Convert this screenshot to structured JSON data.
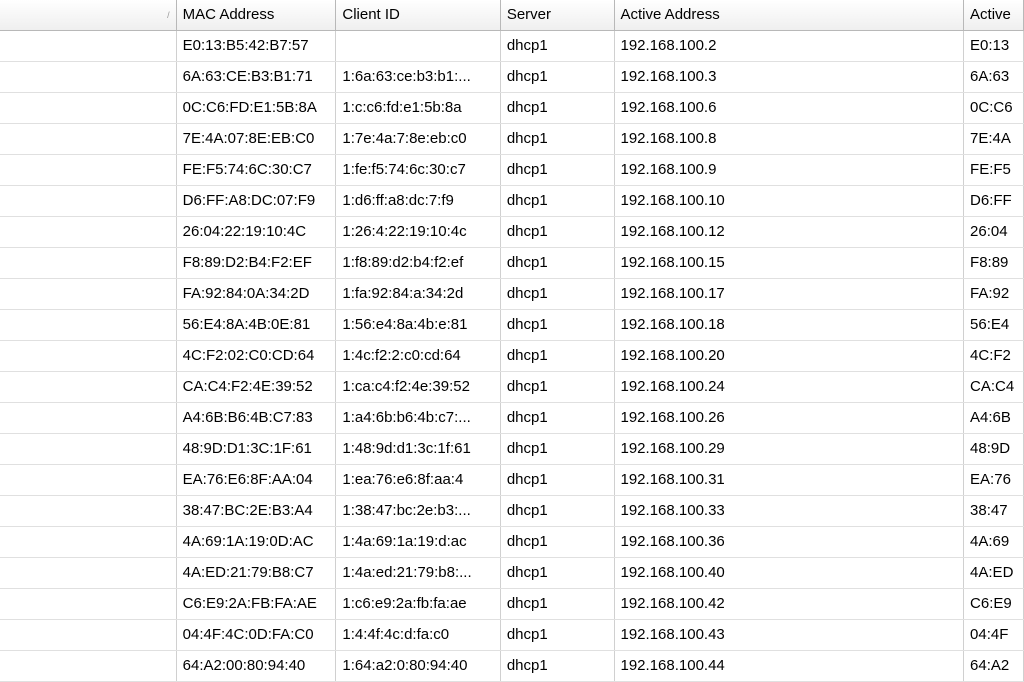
{
  "columns": {
    "empty": "",
    "mac": "MAC Address",
    "client": "Client ID",
    "server": "Server",
    "active_addr": "Active Address",
    "active_mac": "Active"
  },
  "rows": [
    {
      "mac": "E0:13:B5:42:B7:57",
      "client": "",
      "server": "dhcp1",
      "active_addr": "192.168.100.2",
      "active_mac": "E0:13"
    },
    {
      "mac": "6A:63:CE:B3:B1:71",
      "client": "1:6a:63:ce:b3:b1:...",
      "server": "dhcp1",
      "active_addr": "192.168.100.3",
      "active_mac": "6A:63"
    },
    {
      "mac": "0C:C6:FD:E1:5B:8A",
      "client": "1:c:c6:fd:e1:5b:8a",
      "server": "dhcp1",
      "active_addr": "192.168.100.6",
      "active_mac": "0C:C6"
    },
    {
      "mac": "7E:4A:07:8E:EB:C0",
      "client": "1:7e:4a:7:8e:eb:c0",
      "server": "dhcp1",
      "active_addr": "192.168.100.8",
      "active_mac": "7E:4A"
    },
    {
      "mac": "FE:F5:74:6C:30:C7",
      "client": "1:fe:f5:74:6c:30:c7",
      "server": "dhcp1",
      "active_addr": "192.168.100.9",
      "active_mac": "FE:F5"
    },
    {
      "mac": "D6:FF:A8:DC:07:F9",
      "client": "1:d6:ff:a8:dc:7:f9",
      "server": "dhcp1",
      "active_addr": "192.168.100.10",
      "active_mac": "D6:FF"
    },
    {
      "mac": "26:04:22:19:10:4C",
      "client": "1:26:4:22:19:10:4c",
      "server": "dhcp1",
      "active_addr": "192.168.100.12",
      "active_mac": "26:04"
    },
    {
      "mac": "F8:89:D2:B4:F2:EF",
      "client": "1:f8:89:d2:b4:f2:ef",
      "server": "dhcp1",
      "active_addr": "192.168.100.15",
      "active_mac": "F8:89"
    },
    {
      "mac": "FA:92:84:0A:34:2D",
      "client": "1:fa:92:84:a:34:2d",
      "server": "dhcp1",
      "active_addr": "192.168.100.17",
      "active_mac": "FA:92"
    },
    {
      "mac": "56:E4:8A:4B:0E:81",
      "client": "1:56:e4:8a:4b:e:81",
      "server": "dhcp1",
      "active_addr": "192.168.100.18",
      "active_mac": "56:E4"
    },
    {
      "mac": "4C:F2:02:C0:CD:64",
      "client": "1:4c:f2:2:c0:cd:64",
      "server": "dhcp1",
      "active_addr": "192.168.100.20",
      "active_mac": "4C:F2"
    },
    {
      "mac": "CA:C4:F2:4E:39:52",
      "client": "1:ca:c4:f2:4e:39:52",
      "server": "dhcp1",
      "active_addr": "192.168.100.24",
      "active_mac": "CA:C4"
    },
    {
      "mac": "A4:6B:B6:4B:C7:83",
      "client": "1:a4:6b:b6:4b:c7:...",
      "server": "dhcp1",
      "active_addr": "192.168.100.26",
      "active_mac": "A4:6B"
    },
    {
      "mac": "48:9D:D1:3C:1F:61",
      "client": "1:48:9d:d1:3c:1f:61",
      "server": "dhcp1",
      "active_addr": "192.168.100.29",
      "active_mac": "48:9D"
    },
    {
      "mac": "EA:76:E6:8F:AA:04",
      "client": "1:ea:76:e6:8f:aa:4",
      "server": "dhcp1",
      "active_addr": "192.168.100.31",
      "active_mac": "EA:76"
    },
    {
      "mac": "38:47:BC:2E:B3:A4",
      "client": "1:38:47:bc:2e:b3:...",
      "server": "dhcp1",
      "active_addr": "192.168.100.33",
      "active_mac": "38:47"
    },
    {
      "mac": "4A:69:1A:19:0D:AC",
      "client": "1:4a:69:1a:19:d:ac",
      "server": "dhcp1",
      "active_addr": "192.168.100.36",
      "active_mac": "4A:69"
    },
    {
      "mac": "4A:ED:21:79:B8:C7",
      "client": "1:4a:ed:21:79:b8:...",
      "server": "dhcp1",
      "active_addr": "192.168.100.40",
      "active_mac": "4A:ED"
    },
    {
      "mac": "C6:E9:2A:FB:FA:AE",
      "client": "1:c6:e9:2a:fb:fa:ae",
      "server": "dhcp1",
      "active_addr": "192.168.100.42",
      "active_mac": "C6:E9"
    },
    {
      "mac": "04:4F:4C:0D:FA:C0",
      "client": "1:4:4f:4c:d:fa:c0",
      "server": "dhcp1",
      "active_addr": "192.168.100.43",
      "active_mac": "04:4F"
    },
    {
      "mac": "64:A2:00:80:94:40",
      "client": "1:64:a2:0:80:94:40",
      "server": "dhcp1",
      "active_addr": "192.168.100.44",
      "active_mac": "64:A2"
    }
  ]
}
